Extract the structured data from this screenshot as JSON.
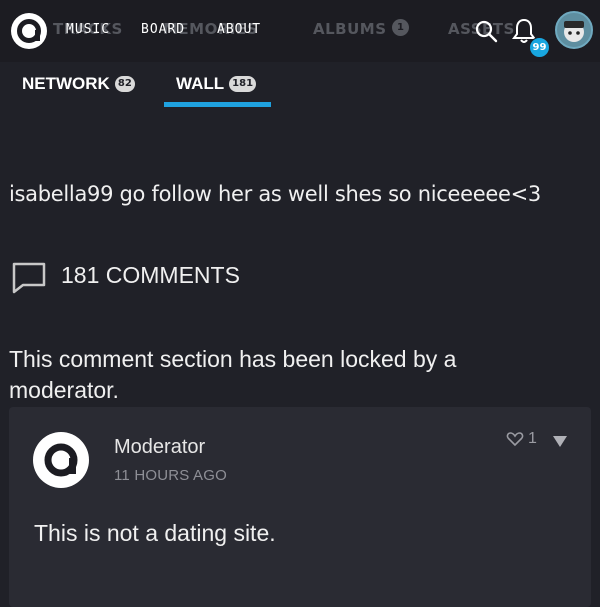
{
  "topbar": {
    "ghost_nav": {
      "tracks_label": "TRACKS",
      "tracks_badge": "",
      "memories_label": "MEMORIES",
      "memories_badge": "",
      "albums_label": "ALBUMS",
      "albums_badge": "1",
      "assets_label": "ASSETS",
      "assets_badge": ""
    },
    "nav": [
      "MUSIC",
      "BOARD",
      "ABOUT"
    ],
    "notification_count": "99",
    "icons": [
      "amino-logo-icon",
      "search-icon",
      "bell-icon",
      "avatar"
    ]
  },
  "subnav": {
    "tabs": [
      {
        "label": "NETWORK",
        "badge": "82"
      },
      {
        "label": "WALL",
        "badge": "181",
        "active": true
      }
    ],
    "accent_color": "#1fa2e0"
  },
  "post": {
    "text": "isabella99 go follow her as well shes so niceeeee<3"
  },
  "comments": {
    "count_label": "181 COMMENTS",
    "locked_notice": "This comment section has been locked by a moderator."
  },
  "moderator_comment": {
    "author": "Moderator",
    "time": "11 HOURS AGO",
    "likes": "1",
    "text": "This is not a dating site."
  }
}
